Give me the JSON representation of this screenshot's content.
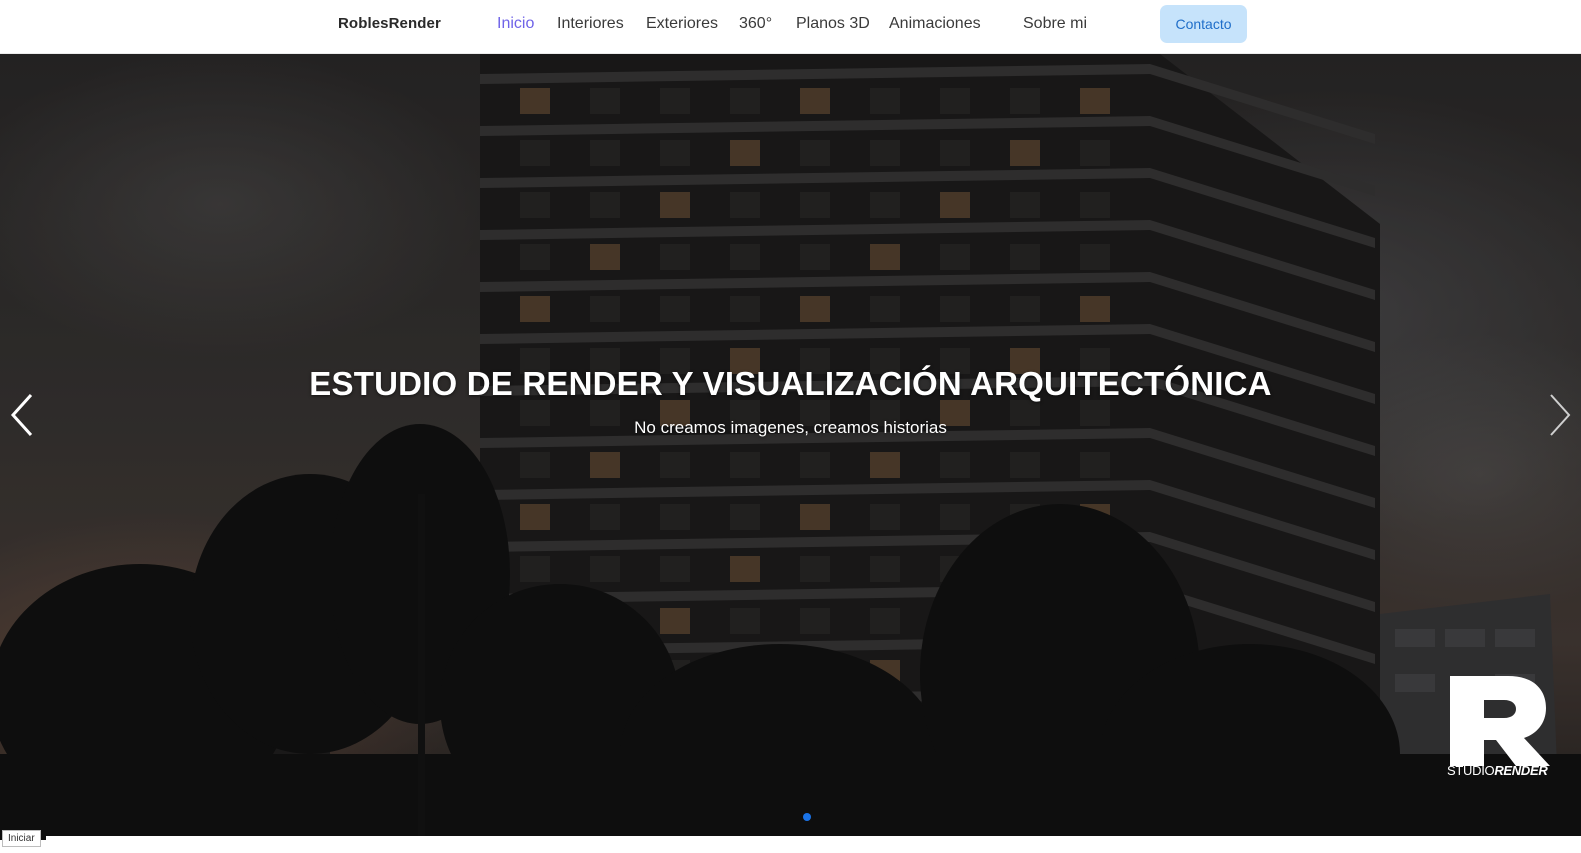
{
  "nav": {
    "brand": "RoblesRender",
    "links": [
      {
        "label": "Inicio",
        "active": true
      },
      {
        "label": "Interiores",
        "active": false
      },
      {
        "label": "Exteriores",
        "active": false
      },
      {
        "label": "360°",
        "active": false
      },
      {
        "label": "Planos 3D",
        "active": false
      },
      {
        "label": "Animaciones",
        "active": false
      },
      {
        "label": "Sobre mi",
        "active": false
      }
    ],
    "contact_label": "Contacto"
  },
  "hero": {
    "title": "ESTUDIO DE RENDER Y VISUALIZACIÓN ARQUITECTÓNICA",
    "subtitle": "No creamos imagenes, creamos historias",
    "prev_icon": "chevron-left-icon",
    "next_icon": "chevron-right-icon",
    "active_slide": 1,
    "slide_count": 1
  },
  "logo": {
    "letter": "R",
    "word_regular": "STUDIO",
    "word_bold": "RENDER"
  },
  "status": {
    "label": "Iniciar"
  },
  "colors": {
    "active_link": "#6f63e8",
    "contact_bg": "#c6e3fb",
    "contact_text": "#1f6ec9",
    "dot_active": "#1a73e8"
  }
}
